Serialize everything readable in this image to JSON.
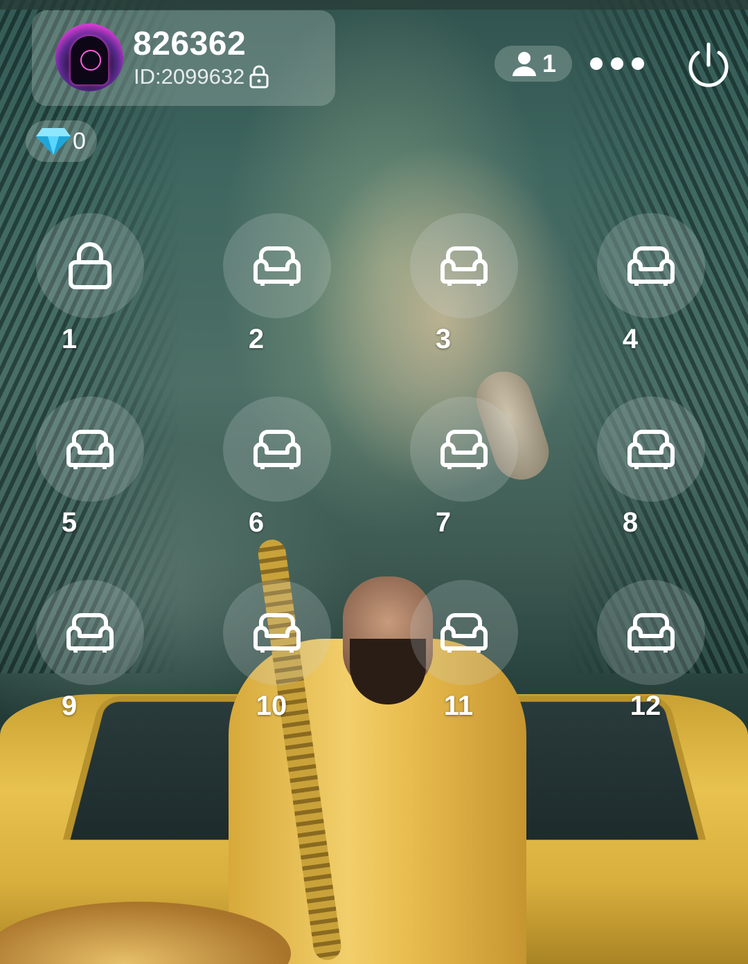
{
  "room": {
    "name": "826362",
    "id_text": "ID:2099632",
    "avatar_icon": "hooded-neon-avatar"
  },
  "header": {
    "online_count": "1",
    "online_icon": "user-icon",
    "more_icon": "more-dots-icon",
    "power_icon": "power-icon"
  },
  "wallet": {
    "diamond_icon": "diamond-icon",
    "diamonds": "0"
  },
  "seats": [
    {
      "number": "1",
      "icon": "lock-icon",
      "locked": true
    },
    {
      "number": "2",
      "icon": "sofa-icon",
      "locked": false
    },
    {
      "number": "3",
      "icon": "sofa-icon",
      "locked": false
    },
    {
      "number": "4",
      "icon": "sofa-icon",
      "locked": false
    },
    {
      "number": "5",
      "icon": "sofa-icon",
      "locked": false
    },
    {
      "number": "6",
      "icon": "sofa-icon",
      "locked": false
    },
    {
      "number": "7",
      "icon": "sofa-icon",
      "locked": false
    },
    {
      "number": "8",
      "icon": "sofa-icon",
      "locked": false
    },
    {
      "number": "9",
      "icon": "sofa-icon",
      "locked": false
    },
    {
      "number": "10",
      "icon": "sofa-icon",
      "locked": false
    },
    {
      "number": "11",
      "icon": "sofa-icon",
      "locked": false
    },
    {
      "number": "12",
      "icon": "sofa-icon",
      "locked": false
    }
  ],
  "colors": {
    "overlay": "#cdd7d4",
    "text": "#ffffff",
    "diamond": "#35c7f0"
  }
}
